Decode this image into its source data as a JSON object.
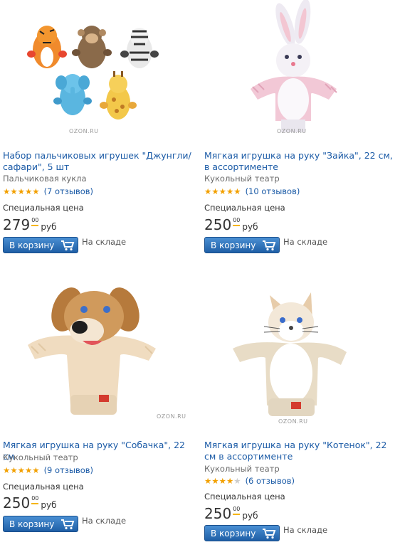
{
  "products": [
    {
      "title": "Набор пальчиковых игрушек \"Джунгли/сафари\", 5 шт",
      "category": "Пальчиковая кукла",
      "stars": 5,
      "reviews": "(7 отзывов)",
      "special_label": "Специальная цена",
      "price_rub": "279",
      "price_kop": "00",
      "currency": "руб",
      "cart_label": "В корзину",
      "stock": "На складе",
      "watermark": "OZON.RU"
    },
    {
      "title": "Мягкая игрушка на руку \"Зайка\", 22 см, в ассортименте",
      "category": "Кукольный театр",
      "stars": 5,
      "reviews": "(10 отзывов)",
      "special_label": "Специальная цена",
      "price_rub": "250",
      "price_kop": "00",
      "currency": "руб",
      "cart_label": "В корзину",
      "stock": "На складе",
      "watermark": "OZON.RU"
    },
    {
      "title": "Мягкая игрушка на руку \"Собачка\", 22 см",
      "category": "Кукольный театр",
      "stars": 5,
      "reviews": "(9 отзывов)",
      "special_label": "Специальная цена",
      "price_rub": "250",
      "price_kop": "00",
      "currency": "руб",
      "cart_label": "В корзину",
      "stock": "На складе",
      "watermark": "OZON.RU"
    },
    {
      "title": "Мягкая игрушка на руку \"Котенок\", 22 см в ассортименте",
      "category": "Кукольный театр",
      "stars": 4,
      "reviews": "(6 отзывов)",
      "special_label": "Специальная цена",
      "price_rub": "250",
      "price_kop": "00",
      "currency": "руб",
      "cart_label": "В корзину",
      "stock": "На складе",
      "watermark": "OZON.RU"
    }
  ],
  "colors": {
    "link": "#1a5aa6",
    "button": "#2f74c0",
    "star": "#f2a000",
    "price_underline": "#f5b400"
  },
  "icons": {
    "cart": "shopping-cart-icon",
    "star": "star-icon"
  }
}
